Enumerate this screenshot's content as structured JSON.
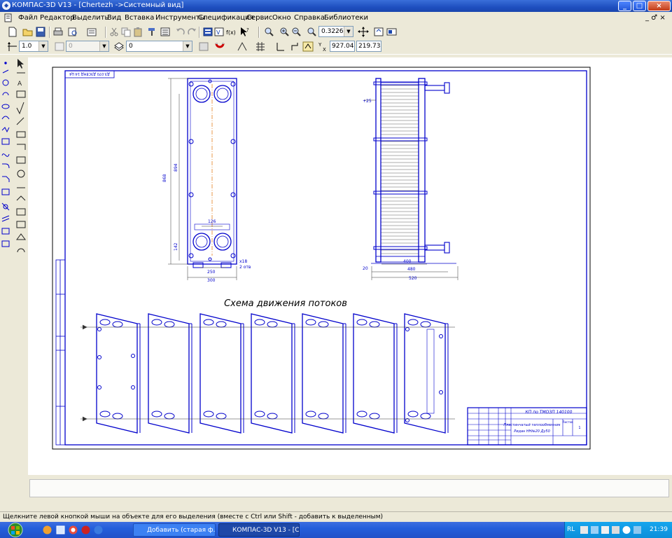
{
  "window": {
    "title": "КОМПАС-3D V13 - [Chertezh ->Системный вид]",
    "minimize": "_",
    "maximize": "□",
    "close": "×"
  },
  "menu": {
    "items": [
      "Файл",
      "Редактор",
      "Выделить",
      "Вид",
      "Вставка",
      "Инструменты",
      "Спецификация",
      "Сервис",
      "Окно",
      "Справка",
      "Библиотеки"
    ],
    "child_controls": "_ ♂ ×"
  },
  "toolbar": {
    "zoom_value": "0.3226",
    "line_width": "1.0",
    "style_value": "0",
    "layer_value": "0",
    "coord_x": "927.047",
    "coord_y": "219.734"
  },
  "drawing": {
    "stamp_topleft": "ДЗ.070 ДЗСЕНД 14 Ц4",
    "flow_title": "Схема движения потоков",
    "doc_code": "КП по ТМОЗП 140100",
    "doc_name": "Пластинчатый теплообменник",
    "doc_name2": "Ридан НН№20 Ду50",
    "sheet_label": "Листов",
    "sheet_no": "1",
    "dims": {
      "d_894": "894",
      "d_868": "868",
      "d_126": "126",
      "d_142": "142",
      "d_250": "250",
      "d_300": "300",
      "d_x18": "х18",
      "d_2otv": "2 отв",
      "d_25": "+25",
      "d_400": "400",
      "d_480": "480",
      "d_520": "520",
      "d_20": "20"
    }
  },
  "status": {
    "message": "Щелкните левой кнопкой мыши на объекте для его выделения (вместе с Ctrl или Shift - добавить к выделенным)"
  },
  "taskbar": {
    "tasks": [
      {
        "label": "Добавить (старая ф...",
        "active": false
      },
      {
        "label": "КОМПАС-3D V13 - [С...",
        "active": true
      }
    ],
    "language": "RL",
    "clock": "21:39"
  }
}
